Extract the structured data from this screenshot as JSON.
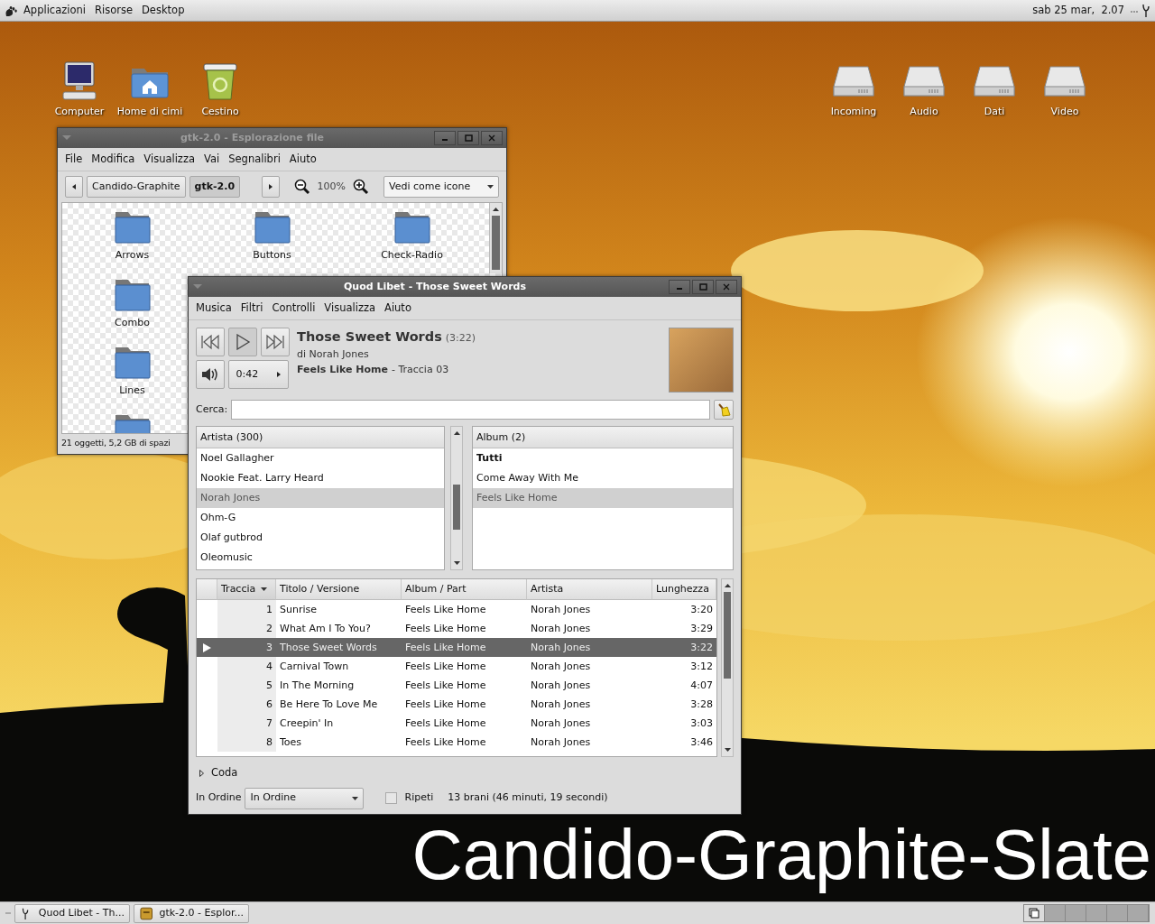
{
  "top_panel": {
    "menus": [
      "Applicazioni",
      "Risorse",
      "Desktop"
    ],
    "clock": "sab 25 mar,  2.07"
  },
  "desktop": {
    "left_icons": [
      {
        "label": "Computer",
        "kind": "computer"
      },
      {
        "label": "Home di cimi",
        "kind": "home"
      },
      {
        "label": "Cestino",
        "kind": "trash"
      }
    ],
    "right_icons": [
      {
        "label": "Incoming",
        "kind": "drive"
      },
      {
        "label": "Audio",
        "kind": "drive"
      },
      {
        "label": "Dati",
        "kind": "drive"
      },
      {
        "label": "Video",
        "kind": "drive"
      }
    ],
    "caption": "Candido-Graphite-Slate"
  },
  "file_manager": {
    "title": "gtk-2.0 - Esplorazione file",
    "active": false,
    "menus": [
      "File",
      "Modifica",
      "Visualizza",
      "Vai",
      "Segnalibri",
      "Aiuto"
    ],
    "path_buttons": [
      {
        "label": "Candido-Graphite",
        "selected": false
      },
      {
        "label": "gtk-2.0",
        "selected": true
      }
    ],
    "zoom": "100%",
    "view": "Vedi come icone",
    "items": [
      "Arrows",
      "Buttons",
      "Check-Radio",
      "Combo",
      "Lines"
    ],
    "status": "21 oggetti, 5,2 GB di spazi"
  },
  "player": {
    "title": "Quod Libet - Those Sweet Words",
    "active": true,
    "menus": [
      "Musica",
      "Filtri",
      "Controlli",
      "Visualizza",
      "Aiuto"
    ],
    "time": "0:42",
    "song": {
      "title": "Those Sweet Words",
      "length": "(3:22)",
      "by": "di Norah Jones",
      "album": "Feels Like Home",
      "track": "- Traccia 03"
    },
    "search": {
      "label": "Cerca:"
    },
    "artists": {
      "header": "Artista (300)",
      "items": [
        {
          "name": "Noel Gallagher",
          "selected": false
        },
        {
          "name": "Nookie Feat. Larry Heard",
          "selected": false
        },
        {
          "name": "Norah Jones",
          "selected": true
        },
        {
          "name": "Ohm-G",
          "selected": false
        },
        {
          "name": "Olaf gutbrod",
          "selected": false
        },
        {
          "name": "Oleomusic",
          "selected": false
        }
      ]
    },
    "albums": {
      "header": "Album (2)",
      "items": [
        {
          "name": "Tutti",
          "kind": "all",
          "selected": false
        },
        {
          "name": "Come Away With Me",
          "kind": "album",
          "selected": false
        },
        {
          "name": "Feels Like Home",
          "kind": "album",
          "selected": true
        }
      ]
    },
    "table": {
      "columns": [
        {
          "label": "Traccia",
          "sorted": true
        },
        {
          "label": "Titolo / Versione",
          "sorted": false
        },
        {
          "label": "Album / Part",
          "sorted": false
        },
        {
          "label": "Artista",
          "sorted": false
        },
        {
          "label": "Lunghezza",
          "sorted": false
        }
      ],
      "rows": [
        {
          "cells": [
            "1",
            "Sunrise",
            "Feels Like Home",
            "Norah Jones",
            "3:20"
          ],
          "selected": false,
          "playing": false
        },
        {
          "cells": [
            "2",
            "What Am I To You?",
            "Feels Like Home",
            "Norah Jones",
            "3:29"
          ],
          "selected": false,
          "playing": false
        },
        {
          "cells": [
            "3",
            "Those Sweet Words",
            "Feels Like Home",
            "Norah Jones",
            "3:22"
          ],
          "selected": true,
          "playing": true
        },
        {
          "cells": [
            "4",
            "Carnival Town",
            "Feels Like Home",
            "Norah Jones",
            "3:12"
          ],
          "selected": false,
          "playing": false
        },
        {
          "cells": [
            "5",
            "In The Morning",
            "Feels Like Home",
            "Norah Jones",
            "4:07"
          ],
          "selected": false,
          "playing": false
        },
        {
          "cells": [
            "6",
            "Be Here To Love Me",
            "Feels Like Home",
            "Norah Jones",
            "3:28"
          ],
          "selected": false,
          "playing": false
        },
        {
          "cells": [
            "7",
            "Creepin' In",
            "Feels Like Home",
            "Norah Jones",
            "3:03"
          ],
          "selected": false,
          "playing": false
        },
        {
          "cells": [
            "8",
            "Toes",
            "Feels Like Home",
            "Norah Jones",
            "3:46"
          ],
          "selected": false,
          "playing": false
        }
      ]
    },
    "queue": {
      "label": "Coda",
      "expanded": false
    },
    "order": {
      "label": "In Ordine",
      "value": "In Ordine"
    },
    "repeat": {
      "label": "Ripeti",
      "checked": false
    },
    "summary": "13 brani (46 minuti, 19 secondi)"
  },
  "taskbar": [
    {
      "label": "Quod Libet - Th...",
      "kind": "player",
      "selected": false
    },
    {
      "label": "gtk-2.0 - Esplor...",
      "kind": "files",
      "selected": false
    }
  ]
}
